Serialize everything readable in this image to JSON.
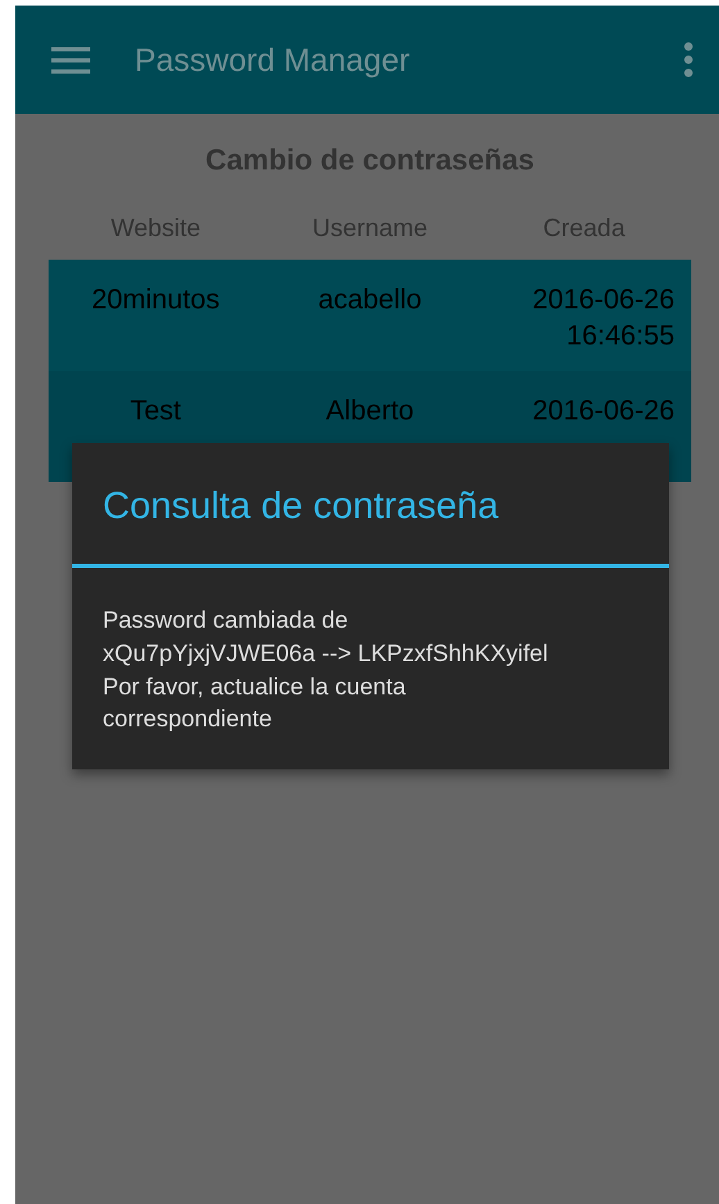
{
  "app_bar": {
    "title": "Password Manager"
  },
  "heading": "Cambio de contraseñas",
  "table": {
    "columns": [
      "Website",
      "Username",
      "Creada"
    ],
    "rows": [
      [
        "20minutos",
        "acabello",
        "2016-06-26\n16:46:55"
      ],
      [
        "Test",
        "Alberto",
        "2016-06-26"
      ]
    ]
  },
  "dialog": {
    "title": "Consulta de contraseña",
    "message": "Password cambiada de\nxQu7pYjxjVJWE06a --> LKPzxfShhKXyifel\nPor favor, actualice la cuenta\ncorrespondiente"
  }
}
